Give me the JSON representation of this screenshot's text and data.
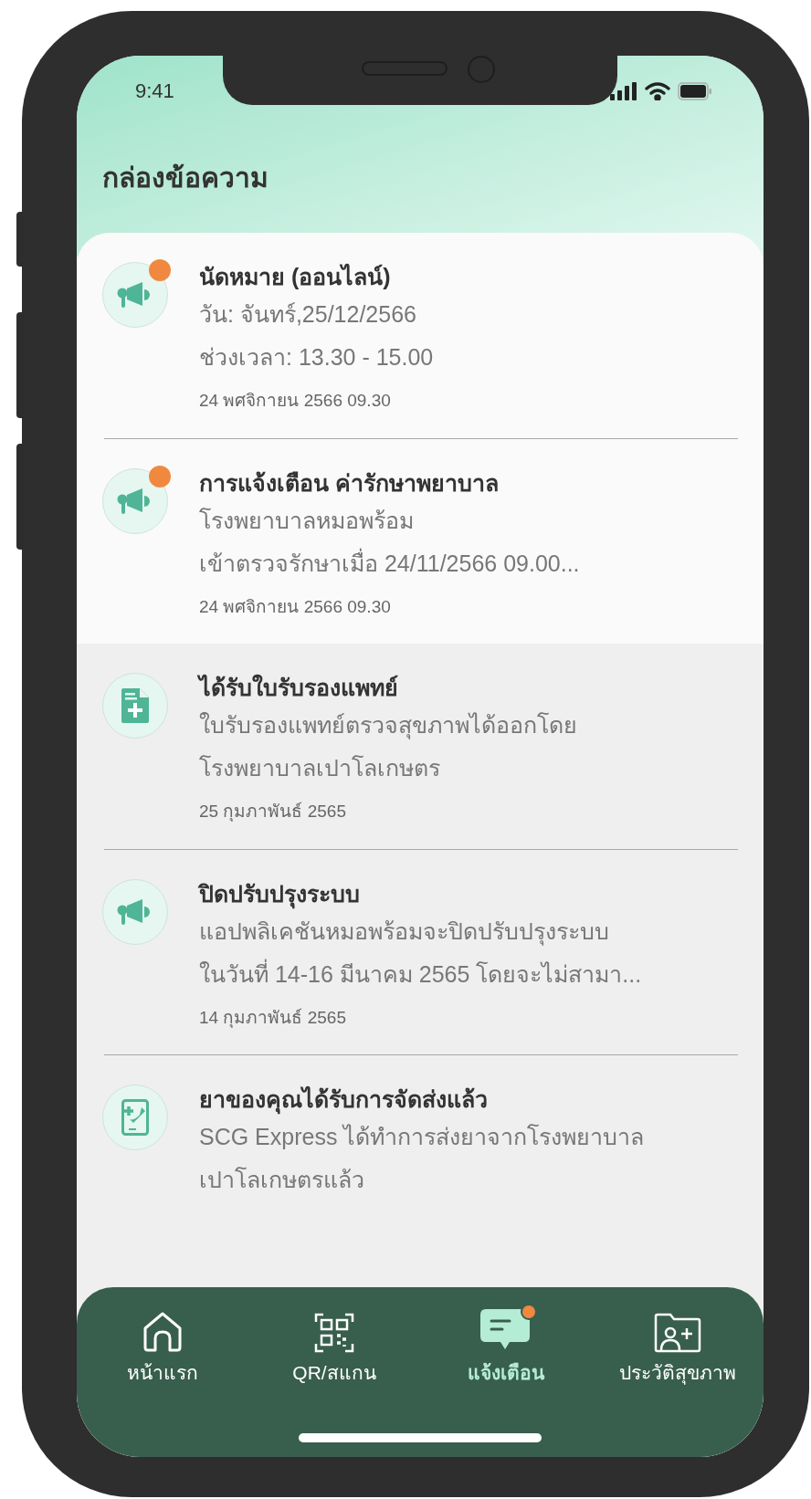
{
  "status_bar": {
    "time": "9:41"
  },
  "header": {
    "title": "กล่องข้อความ"
  },
  "messages": [
    {
      "kind": "megaphone",
      "unread": true,
      "title": "นัดหมาย (ออนไลน์)",
      "lines": [
        "วัน: จันทร์,25/12/2566",
        "ช่วงเวลา: 13.30 - 15.00"
      ],
      "timestamp": "24 พศจิกายน 2566 09.30"
    },
    {
      "kind": "megaphone",
      "unread": true,
      "title": "การแจ้งเตือน ค่ารักษาพยาบาล",
      "lines": [
        "โรงพยาบาลหมอพร้อม",
        "เข้าตรวจรักษาเมื่อ 24/11/2566 09.00..."
      ],
      "timestamp": "24 พศจิกายน 2566 09.30"
    },
    {
      "kind": "certificate",
      "unread": false,
      "title": "ได้รับใบรับรองแพทย์",
      "lines": [
        "ใบรับรองแพทย์ตรวจสุขภาพได้ออกโดย",
        "โรงพยาบาลเปาโลเกษตร"
      ],
      "timestamp": "25 กุมภาพันธ์ 2565"
    },
    {
      "kind": "megaphone",
      "unread": false,
      "title": "ปิดปรับปรุงระบบ",
      "lines": [
        "แอปพลิเคชันหมอพร้อมจะปิดปรับปรุงระบบ",
        "ในวันที่ 14-16 มีนาคม 2565 โดยจะไม่สามา..."
      ],
      "timestamp": "14 กุมภาพันธ์ 2565"
    },
    {
      "kind": "medicine",
      "unread": false,
      "title": "ยาของคุณได้รับการจัดส่งแล้ว",
      "lines": [
        "SCG Express ได้ทำการส่งยาจากโรงพยาบาล",
        "เปาโลเกษตรแล้ว"
      ]
    }
  ],
  "nav": [
    {
      "kind": "home",
      "label": "หน้าแรก",
      "selected": false,
      "badge": false
    },
    {
      "kind": "qr",
      "label": "QR/สแกน",
      "selected": false,
      "badge": false
    },
    {
      "kind": "message",
      "label": "แจ้งเตือน",
      "selected": true,
      "badge": true
    },
    {
      "kind": "folder",
      "label": "ประวัติสุขภาพ",
      "selected": false,
      "badge": false
    }
  ]
}
